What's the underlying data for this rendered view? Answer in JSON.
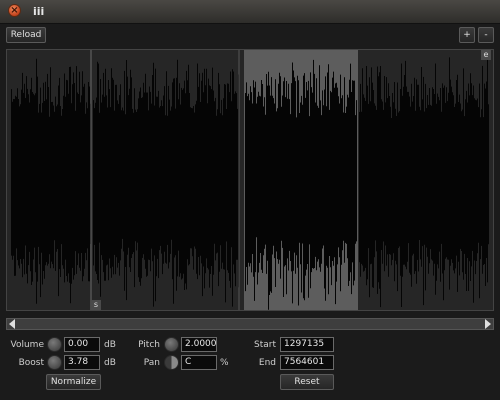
{
  "window": {
    "title": "iii"
  },
  "toolbar": {
    "reload_label": "Reload",
    "zoom_in_label": "+",
    "zoom_out_label": "-"
  },
  "waveform": {
    "start_marker": "s",
    "end_marker": "e"
  },
  "controls": {
    "volume": {
      "label": "Volume",
      "value": "0.00",
      "unit": "dB"
    },
    "boost": {
      "label": "Boost",
      "value": "3.78",
      "unit": "dB"
    },
    "normalize_label": "Normalize",
    "pitch": {
      "label": "Pitch",
      "value": "2.0000"
    },
    "pan": {
      "label": "Pan",
      "value": "C",
      "unit": "%"
    },
    "start": {
      "label": "Start",
      "value": "1297135"
    },
    "end": {
      "label": "End",
      "value": "7564601"
    },
    "reset_label": "Reset"
  }
}
